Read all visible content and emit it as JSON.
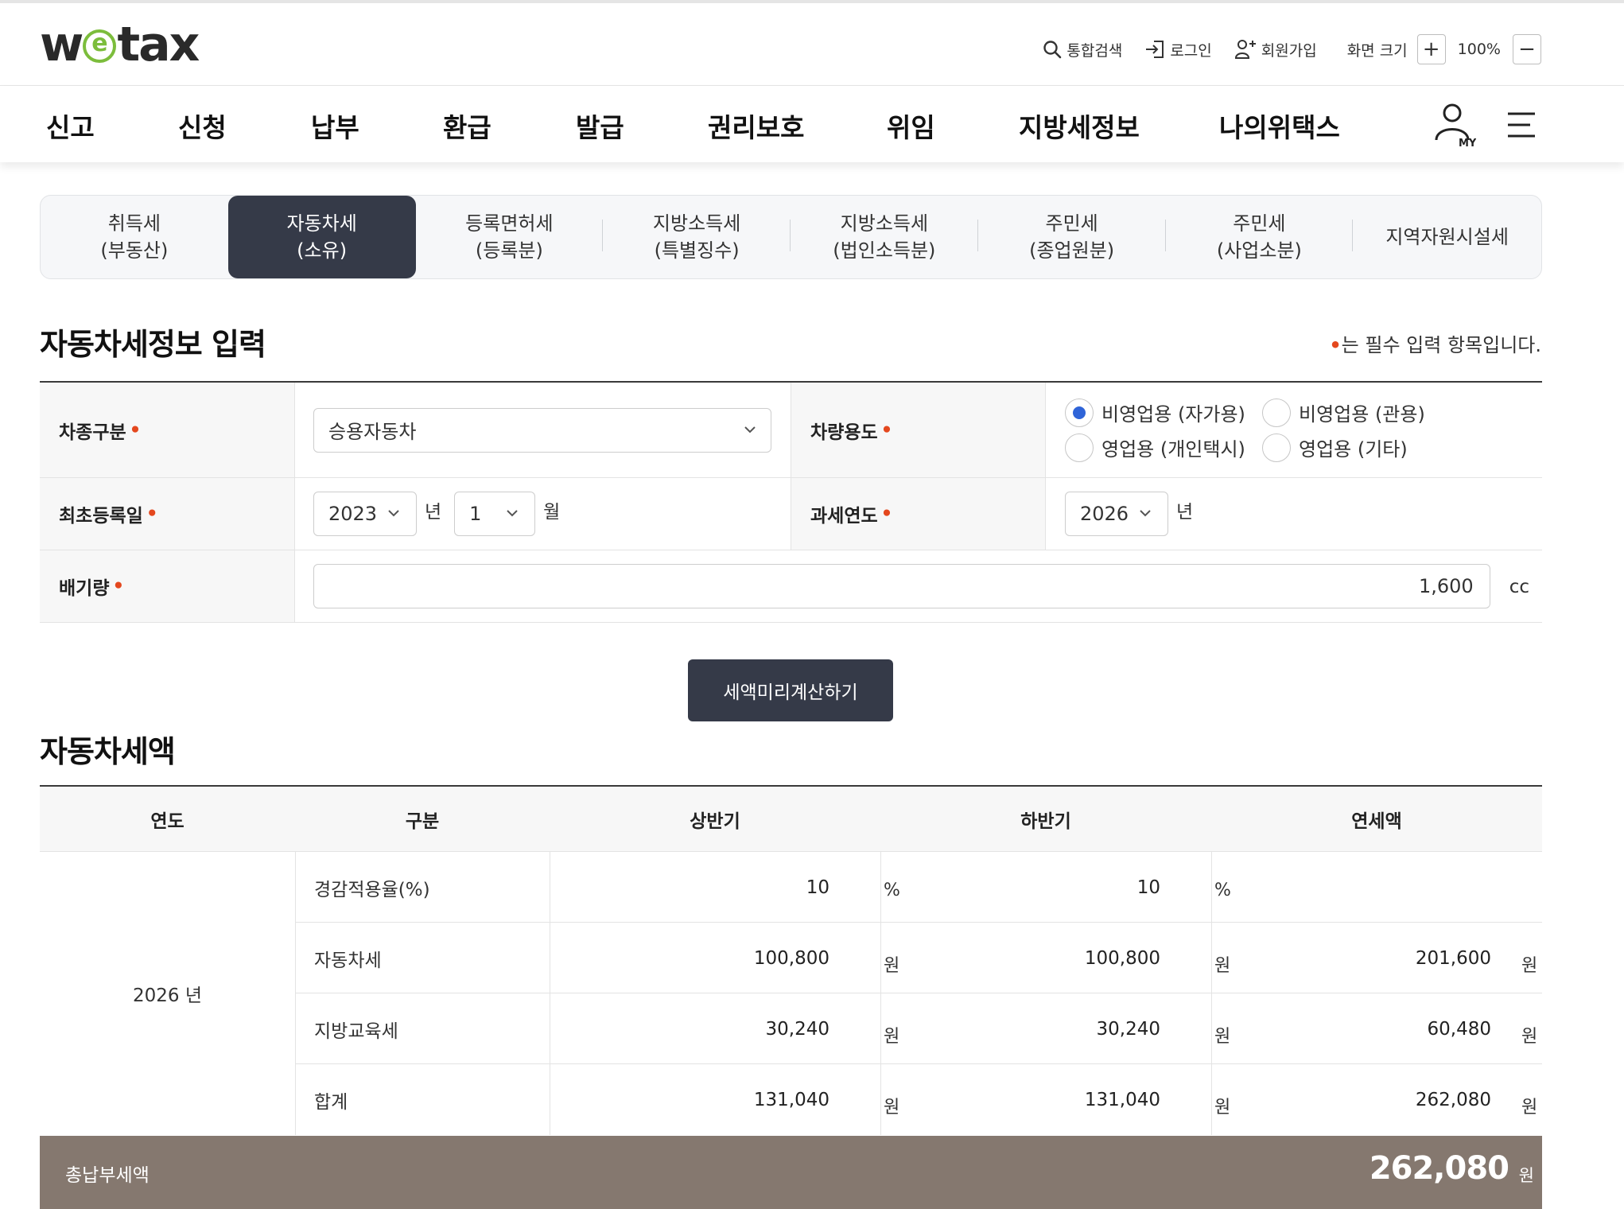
{
  "header": {
    "logo": {
      "w": "w",
      "e": "e",
      "rest": "tax"
    },
    "util": {
      "search": "통합검색",
      "login": "로그인",
      "signup": "회원가입",
      "zoom_label": "화면 크기",
      "zoom_plus": "+",
      "zoom_value": "100%",
      "zoom_minus": "−"
    }
  },
  "nav": {
    "items": [
      "신고",
      "신청",
      "납부",
      "환급",
      "발급",
      "권리보호",
      "위임",
      "지방세정보",
      "나의위택스"
    ],
    "my_label": "MY"
  },
  "tabs": [
    {
      "line1": "취득세",
      "line2": "(부동산)"
    },
    {
      "line1": "자동차세",
      "line2": "(소유)"
    },
    {
      "line1": "등록면허세",
      "line2": "(등록분)"
    },
    {
      "line1": "지방소득세",
      "line2": "(특별징수)"
    },
    {
      "line1": "지방소득세",
      "line2": "(법인소득분)"
    },
    {
      "line1": "주민세",
      "line2": "(종업원분)"
    },
    {
      "line1": "주민세",
      "line2": "(사업소분)"
    },
    {
      "line1": "지역자원시설세",
      "line2": ""
    }
  ],
  "form": {
    "title": "자동차세정보 입력",
    "required_note": "는 필수 입력 항목입니다.",
    "req_mark": "•",
    "vehicle_type": {
      "label": "차종구분",
      "value": "승용자동차"
    },
    "usage": {
      "label": "차량용도",
      "options": [
        "비영업용 (자가용)",
        "비영업용 (관용)",
        "영업용 (개인택시)",
        "영업용 (기타)"
      ],
      "selected": 0
    },
    "first_reg": {
      "label": "최초등록일",
      "year": "2023",
      "year_unit": "년",
      "month": "1",
      "month_unit": "월"
    },
    "tax_year": {
      "label": "과세연도",
      "year": "2026",
      "year_unit": "년"
    },
    "displacement": {
      "label": "배기량",
      "value": "1,600",
      "unit": "cc"
    },
    "calc_button": "세액미리계산하기"
  },
  "result": {
    "title": "자동차세액",
    "headers": [
      "연도",
      "구분",
      "상반기",
      "하반기",
      "연세액"
    ],
    "year": "2026 년",
    "rows": [
      {
        "cat": "경감적용율(%)",
        "h1": "10",
        "h1_unit": "%",
        "h2": "10",
        "h2_unit": "%",
        "annual": "",
        "annual_unit": ""
      },
      {
        "cat": "자동차세",
        "h1": "100,800",
        "h1_unit": "원",
        "h2": "100,800",
        "h2_unit": "원",
        "annual": "201,600",
        "annual_unit": "원"
      },
      {
        "cat": "지방교육세",
        "h1": "30,240",
        "h1_unit": "원",
        "h2": "30,240",
        "h2_unit": "원",
        "annual": "60,480",
        "annual_unit": "원"
      },
      {
        "cat": "합계",
        "h1": "131,040",
        "h1_unit": "원",
        "h2": "131,040",
        "h2_unit": "원",
        "annual": "262,080",
        "annual_unit": "원"
      }
    ],
    "total_label": "총납부세액",
    "total_value": "262,080",
    "total_unit": "원"
  }
}
